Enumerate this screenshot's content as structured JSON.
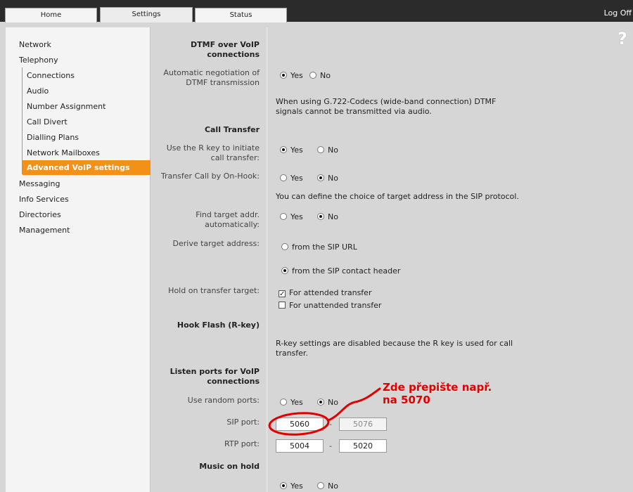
{
  "tabs": {
    "home": "Home",
    "settings": "Settings",
    "status": "Status"
  },
  "logoff": "Log Off",
  "help": "?",
  "sidebar": {
    "items": [
      "Network",
      "Telephony",
      "Messaging",
      "Info Services",
      "Directories",
      "Management"
    ],
    "telephony_sub": [
      "Connections",
      "Audio",
      "Number Assignment",
      "Call Divert",
      "Dialling Plans",
      "Network Mailboxes"
    ],
    "active": "Advanced VoIP settings"
  },
  "dtmf": {
    "title": "DTMF over VoIP connections",
    "auto_label": "Automatic negotiation of DTMF transmission",
    "yes": "Yes",
    "no": "No",
    "selected": "Yes",
    "note": "When using G.722-Codecs (wide-band connection) DTMF signals cannot be transmitted via audio."
  },
  "call_transfer": {
    "title": "Call Transfer",
    "rkey_label": "Use the R key to initiate call transfer:",
    "rkey_selected": "Yes",
    "onhook_label": "Transfer Call by On-Hook:",
    "onhook_selected": "No",
    "note": "You can define the choice of target address in the SIP protocol.",
    "find_label": "Find target addr. automatically:",
    "find_selected": "No",
    "derive_label": "Derive target address:",
    "derive_opt1": "from the SIP URL",
    "derive_opt2": "from the SIP contact header",
    "derive_selected": "from the SIP contact header",
    "hold_label": "Hold on transfer target:",
    "hold_opt1": "For attended transfer",
    "hold_opt1_checked": true,
    "hold_opt2": "For unattended transfer",
    "hold_opt2_checked": false,
    "yes": "Yes",
    "no": "No"
  },
  "hook_flash": {
    "title": "Hook Flash (R-key)",
    "note": "R-key settings are disabled because the R key is used for call transfer."
  },
  "listen_ports": {
    "title": "Listen ports for VoIP connections",
    "random_label": "Use random ports:",
    "random_selected": "No",
    "yes": "Yes",
    "no": "No",
    "sip_label": "SIP port:",
    "sip_from": "5060",
    "sip_to": "5076",
    "rtp_label": "RTP port:",
    "rtp_from": "5004",
    "rtp_to": "5020",
    "dash": "-"
  },
  "music_on_hold": {
    "title": "Music on hold",
    "yes": "Yes",
    "no": "No",
    "selected": "Yes"
  },
  "annotation": {
    "line1": "Zde přepište např.",
    "line2": "na 5070",
    "color": "#e00000"
  },
  "colors": {
    "accent": "#f39018",
    "topbar": "#2b2b2b",
    "background": "#d6d6d6",
    "sidebar": "#f4f4f4"
  }
}
